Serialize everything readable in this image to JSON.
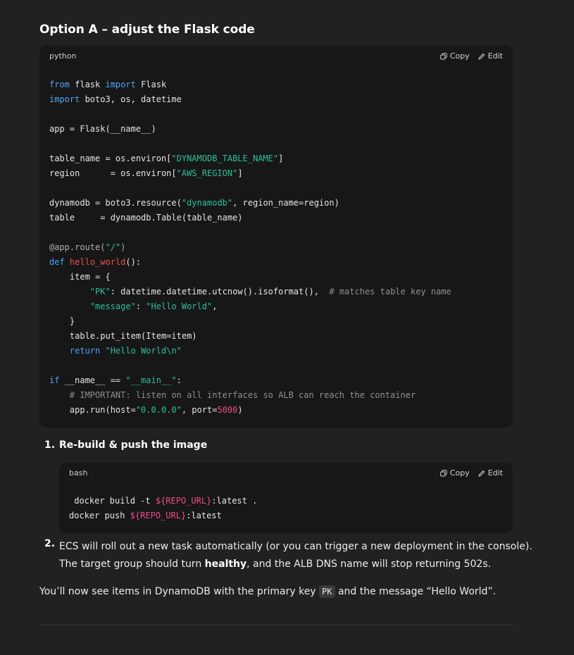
{
  "heading": "Option A – adjust the Flask code",
  "code1": {
    "language": "python",
    "copy_label": "Copy",
    "edit_label": "Edit"
  },
  "steps": [
    {
      "number": "1.",
      "text": "Re-build & push the image"
    },
    {
      "number": "2.",
      "line1": "ECS will roll out a new task automatically (or you can trigger a new deployment in the console).",
      "line2_pre": "The target group should turn ",
      "line2_bold": "healthy",
      "line2_post": ", and the ALB DNS name will stop returning 502s."
    }
  ],
  "code2": {
    "language": "bash",
    "copy_label": "Copy",
    "edit_label": "Edit"
  },
  "closing": {
    "pre": "You’ll now see items in DynamoDB with the primary key ",
    "code": "PK",
    "post": " and the message “Hello World”."
  },
  "icons": {
    "copy": "copy-icon",
    "edit": "edit-icon"
  },
  "colors": {
    "background": "#212121",
    "code_background": "#171717",
    "keyword": "#4fa3f7",
    "string": "#2fbf9b",
    "number": "#e94f8a",
    "function": "#f0504a"
  }
}
